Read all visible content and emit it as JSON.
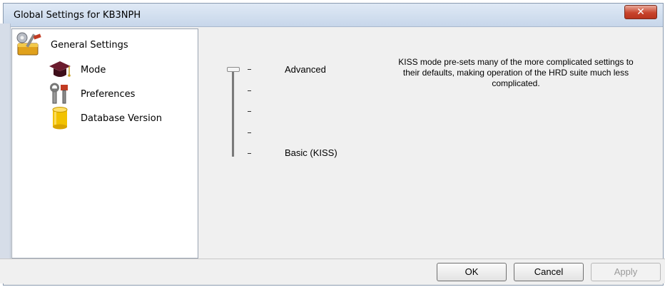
{
  "window": {
    "title": "Global Settings for KB3NPH",
    "close_label": "✕"
  },
  "tree": {
    "items": [
      {
        "label": "General Settings",
        "icon": "tools-gear-icon"
      },
      {
        "label": "Mode",
        "icon": "mortarboard-icon"
      },
      {
        "label": "Preferences",
        "icon": "wrench-icon"
      },
      {
        "label": "Database Version",
        "icon": "database-cylinder-icon"
      }
    ]
  },
  "mode": {
    "level_top": "Advanced",
    "level_bottom": "Basic (KISS)",
    "selected_level": "Advanced",
    "description": "KISS mode pre-sets many of the more complicated settings to their defaults, making operation of the HRD suite much less complicated."
  },
  "buttons": {
    "ok": "OK",
    "cancel": "Cancel",
    "apply": "Apply"
  },
  "colors": {
    "close_button": "#c8442c",
    "database_icon": "#f2c200",
    "mode_icon": "#6b1c2e"
  }
}
